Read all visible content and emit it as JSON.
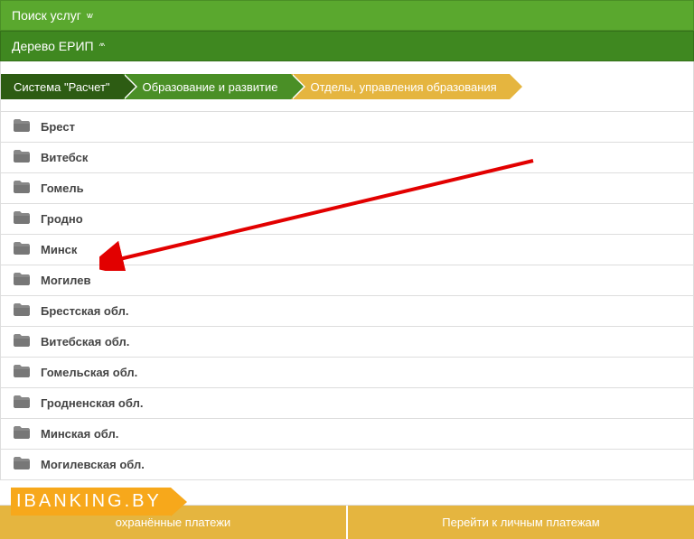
{
  "header": {
    "search": "Поиск услуг",
    "tree": "Дерево ЕРИП"
  },
  "breadcrumb": [
    {
      "label": "Система \"Расчет\"",
      "style": "dark"
    },
    {
      "label": "Образование и развитие",
      "style": "green"
    },
    {
      "label": "Отделы, управления образования",
      "style": "yellow"
    }
  ],
  "items": [
    "Брест",
    "Витебск",
    "Гомель",
    "Гродно",
    "Минск",
    "Могилев",
    "Брестская обл.",
    "Витебская обл.",
    "Гомельская обл.",
    "Гродненская обл.",
    "Минская обл.",
    "Могилевская обл."
  ],
  "footer": {
    "saved": "охранённые платежи",
    "personal": "Перейти к личным платежам"
  },
  "watermark": "IBANKING.BY",
  "colors": {
    "green": "#5aa82e",
    "darkgreen": "#2d5c13",
    "midgreen": "#4a8f26",
    "yellow": "#e5b53f",
    "orange": "#f7a81b",
    "red": "#e20000"
  }
}
